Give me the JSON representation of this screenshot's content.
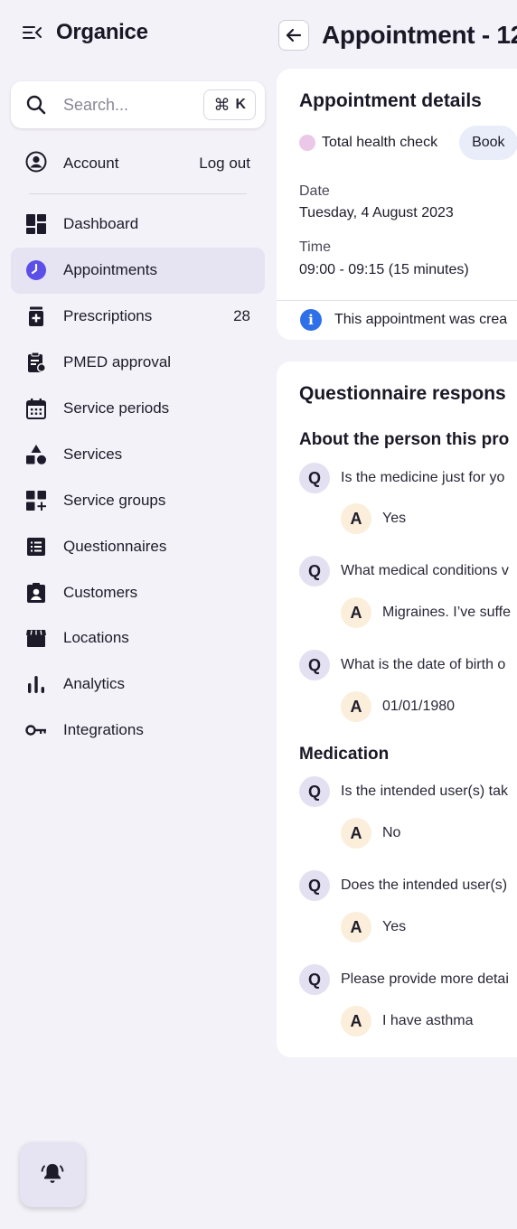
{
  "app": {
    "name": "Organice"
  },
  "search": {
    "placeholder": "Search...",
    "shortcut_key": "K"
  },
  "account": {
    "label": "Account",
    "logout": "Log out"
  },
  "nav": [
    {
      "label": "Dashboard",
      "icon": "dashboard-icon"
    },
    {
      "label": "Appointments",
      "icon": "clock-icon",
      "active": true
    },
    {
      "label": "Prescriptions",
      "icon": "prescription-icon",
      "count": "28"
    },
    {
      "label": "PMED approval",
      "icon": "clipboard-icon"
    },
    {
      "label": "Service periods",
      "icon": "calendar-icon"
    },
    {
      "label": "Services",
      "icon": "shapes-icon"
    },
    {
      "label": "Service groups",
      "icon": "grid-plus-icon"
    },
    {
      "label": "Questionnaires",
      "icon": "list-icon"
    },
    {
      "label": "Customers",
      "icon": "person-badge-icon"
    },
    {
      "label": "Locations",
      "icon": "store-icon"
    },
    {
      "label": "Analytics",
      "icon": "bar-chart-icon"
    },
    {
      "label": "Integrations",
      "icon": "key-icon"
    }
  ],
  "page": {
    "title": "Appointment - 12"
  },
  "appointment": {
    "title": "Appointment details",
    "service": "Total health check",
    "status": "Book",
    "date_label": "Date",
    "date_value": "Tuesday, 4 August 2023",
    "time_label": "Time",
    "time_value": "09:00 - 09:15 (15 minutes)",
    "info": "This appointment was crea"
  },
  "questionnaire": {
    "title": "Questionnaire respons",
    "q_badge": "Q",
    "a_badge": "A",
    "sections": [
      {
        "heading": "About the person this pro",
        "items": [
          {
            "q": "Is the medicine just for yo",
            "a": "Yes"
          },
          {
            "q": "What medical conditions v",
            "a": "Migraines. I’ve suffe"
          },
          {
            "q": "What is the date of birth o",
            "a": "01/01/1980"
          }
        ]
      },
      {
        "heading": "Medication",
        "items": [
          {
            "q": "Is the intended user(s) tak",
            "a": "No"
          },
          {
            "q": "Does the intended user(s)",
            "a": "Yes"
          },
          {
            "q": "Please provide more detai",
            "a": "I have asthma"
          }
        ]
      }
    ]
  },
  "colors": {
    "background": "#f3f2f8",
    "active_nav": "#e6e3f3",
    "accent": "#5b4fe8",
    "info": "#2f6fe8",
    "q_badge": "#e3e0f1",
    "a_badge": "#fbeedb",
    "service_dot": "#ebc8e8"
  }
}
